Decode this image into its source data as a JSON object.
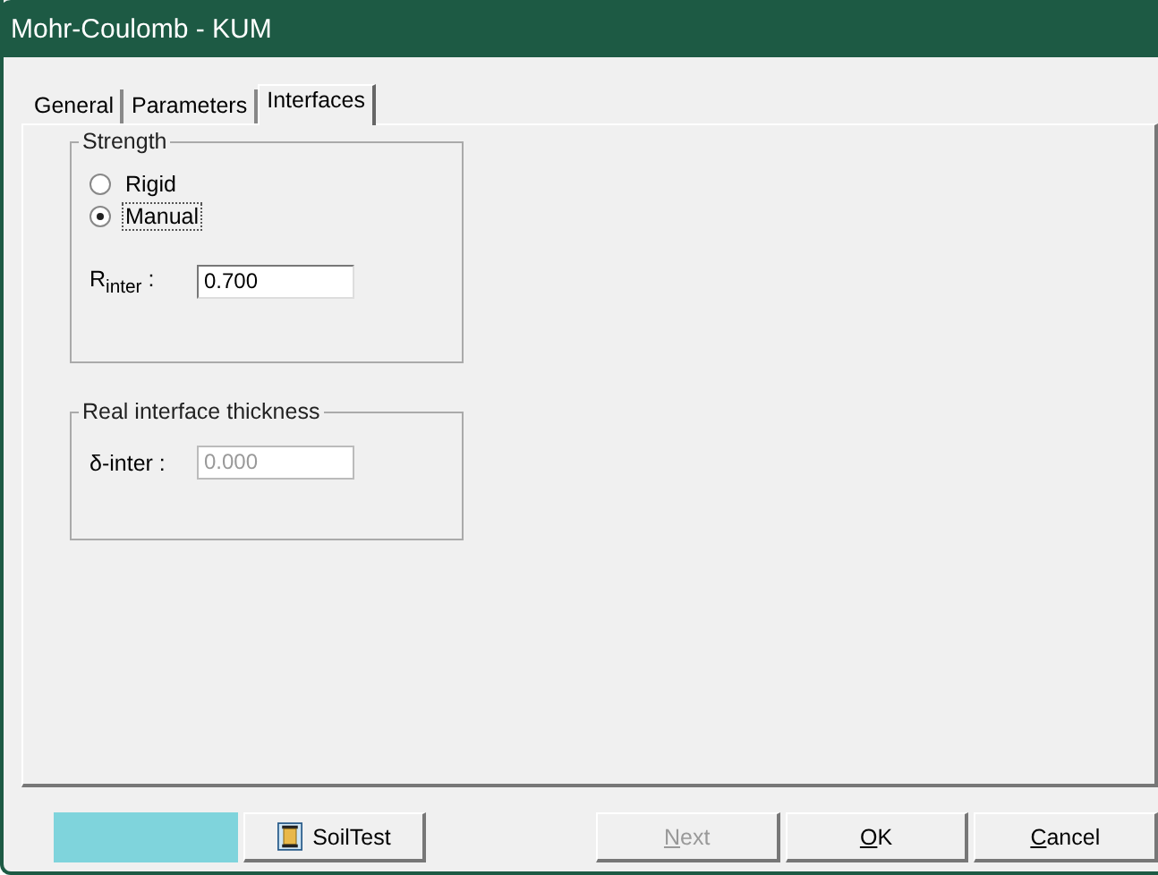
{
  "window": {
    "title": "Mohr-Coulomb - KUM"
  },
  "tabs": [
    {
      "label": "General",
      "selected": false
    },
    {
      "label": "Parameters",
      "selected": false
    },
    {
      "label": "Interfaces",
      "selected": true
    }
  ],
  "strength": {
    "title": "Strength",
    "options": [
      {
        "label": "Rigid",
        "selected": false
      },
      {
        "label": "Manual",
        "selected": true
      }
    ],
    "r_inter": {
      "label": "R$_{inter}$ :",
      "value": "0.700",
      "disabled": false
    }
  },
  "thickness": {
    "title": "Real interface thickness",
    "field": {
      "label": "δ-inter :",
      "value": "0.000",
      "disabled": true
    }
  },
  "buttons": [
    {
      "kind": "swatch",
      "color": "#7fd4dc"
    },
    {
      "kind": "icon",
      "label": "SoilTest",
      "disabled": false
    },
    {
      "kind": "spacer"
    },
    {
      "kind": "text",
      "label": "Next",
      "underline_first": true,
      "disabled": true
    },
    {
      "kind": "text",
      "label": "OK",
      "underline_first": true,
      "disabled": false
    },
    {
      "kind": "text",
      "label": "Cancel",
      "underline_first": true,
      "disabled": false
    }
  ]
}
